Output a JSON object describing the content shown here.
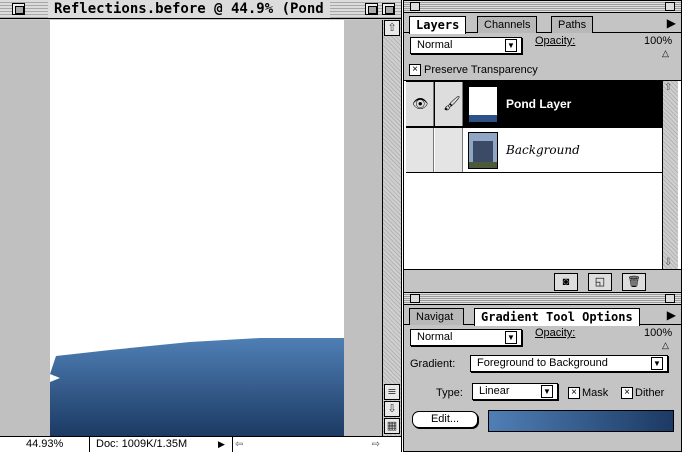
{
  "document": {
    "title": "Reflections.before @ 44.9% (Pond",
    "zoom": "44.93%",
    "doc_size": "Doc: 1009K/1.35M"
  },
  "layers_palette": {
    "tabs": [
      "Layers",
      "Channels",
      "Paths"
    ],
    "blend_mode": "Normal",
    "opacity_label": "Opacity:",
    "opacity_value": "100%",
    "preserve_transparency_label": "Preserve Transparency",
    "preserve_transparency_checked": true,
    "layers": [
      {
        "name": "Pond Layer",
        "selected": true,
        "visible": true
      },
      {
        "name": "Background",
        "selected": false,
        "visible": false
      }
    ]
  },
  "gradient_palette": {
    "tabs": [
      "Navigat",
      "Gradient Tool Options"
    ],
    "blend_mode": "Normal",
    "opacity_label": "Opacity:",
    "opacity_value": "100%",
    "gradient_label": "Gradient:",
    "gradient_value": "Foreground to Background",
    "type_label": "Type:",
    "type_value": "Linear",
    "mask_label": "Mask",
    "mask_checked": true,
    "dither_label": "Dither",
    "dither_checked": true,
    "edit_label": "Edit..."
  },
  "colors": {
    "pond_blue_dark": "#1c3a64",
    "pond_blue_light": "#4f7fb5",
    "panel_gray": "#c4c4c4"
  }
}
